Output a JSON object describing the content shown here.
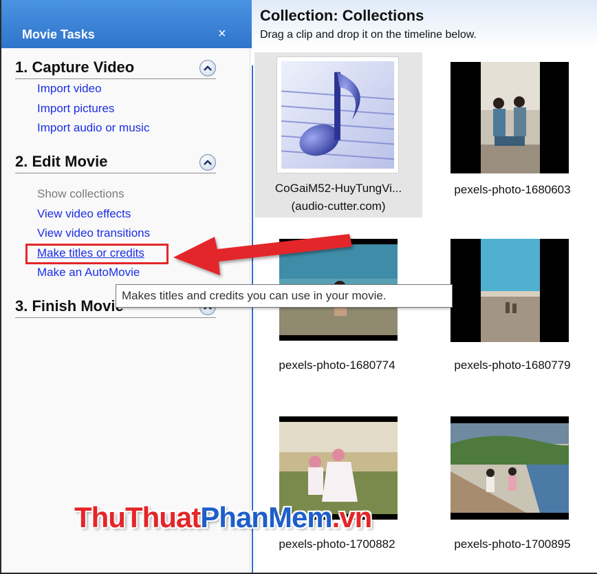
{
  "task_pane": {
    "title": "Movie Tasks",
    "close_glyph": "×",
    "sections": [
      {
        "title": "1. Capture Video",
        "collapse_icon": "chevron-up-icon",
        "items": [
          {
            "label": "Import video",
            "state": "link"
          },
          {
            "label": "Import pictures",
            "state": "link"
          },
          {
            "label": "Import audio or music",
            "state": "link"
          }
        ]
      },
      {
        "title": "2. Edit Movie",
        "collapse_icon": "chevron-up-icon",
        "items": [
          {
            "label": "Show collections",
            "state": "disabled"
          },
          {
            "label": "View video effects",
            "state": "link"
          },
          {
            "label": "View video transitions",
            "state": "link"
          },
          {
            "label": "Make titles or credits",
            "state": "hovered"
          },
          {
            "label": "Make an AutoMovie",
            "state": "link"
          }
        ]
      },
      {
        "title": "3. Finish Movie",
        "collapse_icon": "chevron-up-icon",
        "items": []
      }
    ]
  },
  "tooltip": "Makes titles and credits you can use in your movie.",
  "collection": {
    "title": "Collection: Collections",
    "subtitle": "Drag a clip and drop it on the timeline below.",
    "clips": [
      {
        "label_line1": "CoGaiM52-HuyTungVi...",
        "label_line2": "(audio-cutter.com)",
        "kind": "audio",
        "icon": "music-note-icon",
        "selected": true
      },
      {
        "label_line1": "pexels-photo-1680603",
        "kind": "photo",
        "selected": false
      },
      {
        "label_line1": "pexels-photo-1680774",
        "kind": "photo",
        "selected": false
      },
      {
        "label_line1": "pexels-photo-1680779",
        "kind": "photo",
        "selected": false
      },
      {
        "label_line1": "pexels-photo-1700882",
        "kind": "photo",
        "selected": false
      },
      {
        "label_line1": "pexels-photo-1700895",
        "kind": "photo",
        "selected": false
      }
    ]
  },
  "watermark": {
    "part1": "ThuThuat",
    "part2": "PhanMem",
    "part3": ".vn"
  },
  "colors": {
    "header_blue": "#2f74cb",
    "link_blue": "#1b2ee6",
    "highlight_red": "#e3262a",
    "divider_blue": "#2a6fd4"
  }
}
